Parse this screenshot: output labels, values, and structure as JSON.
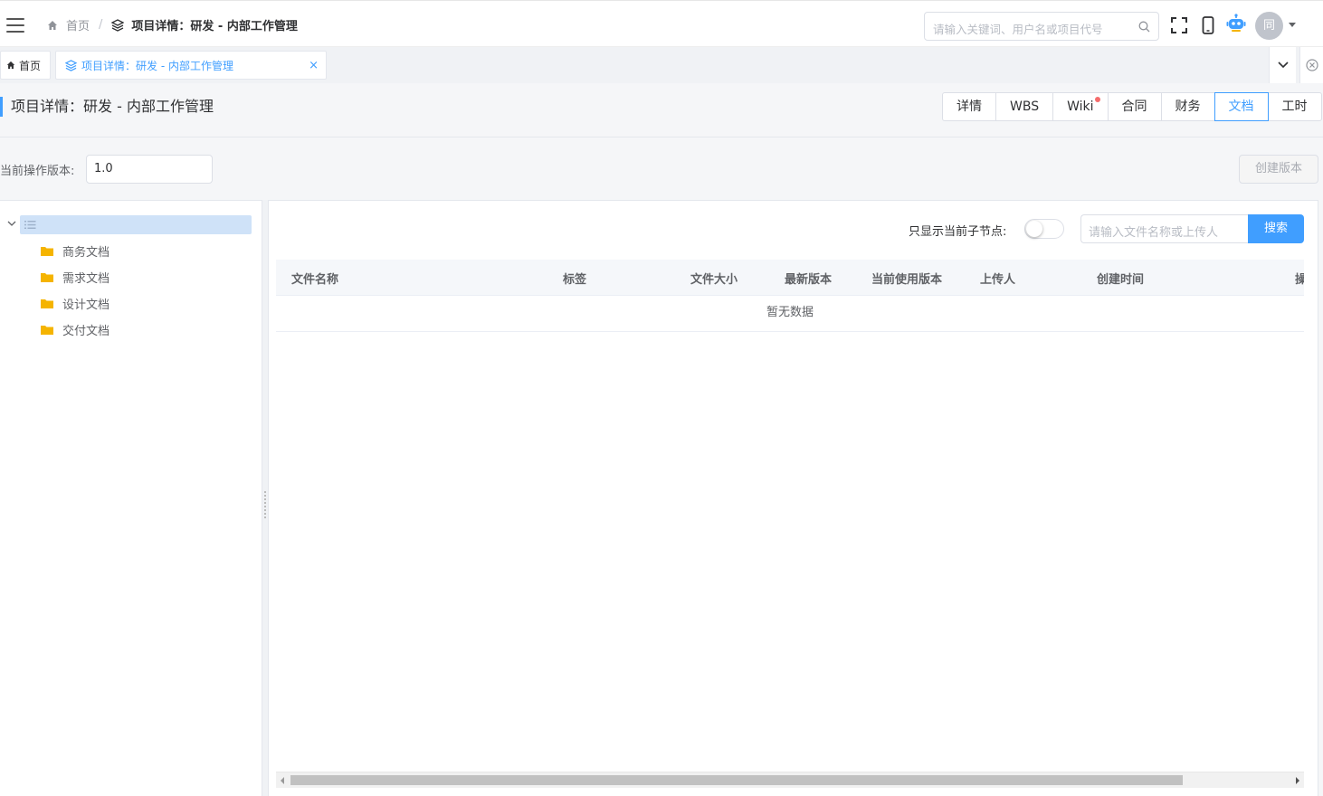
{
  "header": {
    "breadcrumb_home": "首页",
    "breadcrumb_sep": "/",
    "breadcrumb_current": "项目详情：研发 - 内部工作管理",
    "search_placeholder": "请输入关键词、用户名或项目代号",
    "avatar_text": "同"
  },
  "tabs": [
    {
      "label": "首页"
    },
    {
      "label": "项目详情：研发 - 内部工作管理",
      "close": "×"
    }
  ],
  "page": {
    "title": "项目详情：研发 - 内部工作管理",
    "segments": [
      "详情",
      "WBS",
      "Wiki",
      "合同",
      "财务",
      "文档",
      "工时"
    ],
    "active_segment": "文档",
    "wiki_has_notice": true
  },
  "version": {
    "label": "当前操作版本:",
    "value": "1.0",
    "create_button": "创建版本"
  },
  "tree": {
    "nodes": [
      "商务文档",
      "需求文档",
      "设计文档",
      "交付文档"
    ]
  },
  "filter": {
    "toggle_label": "只显示当前子节点:",
    "toggle_on": false,
    "input_placeholder": "请输入文件名称或上传人",
    "search_button": "搜索"
  },
  "table": {
    "columns": [
      "文件名称",
      "标签",
      "文件大小",
      "最新版本",
      "当前使用版本",
      "上传人",
      "创建时间",
      "操"
    ],
    "empty_text": "暂无数据"
  },
  "colors": {
    "primary": "#409eff",
    "notice_dot": "#f56c6c",
    "folder": "#f5b400"
  }
}
